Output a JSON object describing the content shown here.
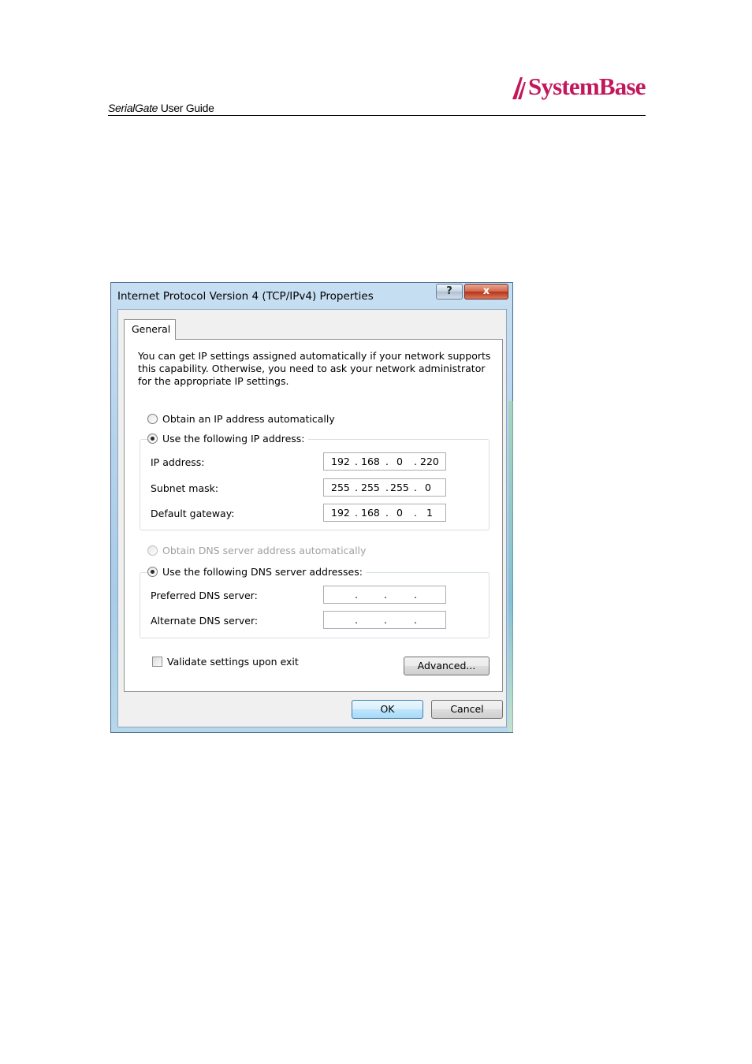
{
  "header": {
    "product": "SerialGate",
    "guide": " User Guide",
    "logo_text": "SystemBase"
  },
  "dialog": {
    "title": "Internet Protocol Version 4 (TCP/IPv4) Properties",
    "help_label": "?",
    "close_label": "x",
    "tab_general": "General",
    "intro": "You can get IP settings assigned automatically if your network supports this capability. Otherwise, you need to ask your network administrator for the appropriate IP settings.",
    "radio_auto_ip": "Obtain an IP address automatically",
    "radio_manual_ip": "Use the following IP address:",
    "ip_label": "IP address:",
    "ip": [
      "192",
      "168",
      "0",
      "220"
    ],
    "subnet_label": "Subnet mask:",
    "subnet": [
      "255",
      "255",
      "255",
      "0"
    ],
    "gateway_label": "Default gateway:",
    "gateway": [
      "192",
      "168",
      "0",
      "1"
    ],
    "radio_auto_dns": "Obtain DNS server address automatically",
    "radio_manual_dns": "Use the following DNS server addresses:",
    "pref_dns_label": "Preferred DNS server:",
    "alt_dns_label": "Alternate DNS server:",
    "validate_label": "Validate settings upon exit",
    "advanced_label": "Advanced...",
    "ok_label": "OK",
    "cancel_label": "Cancel",
    "dot": "."
  }
}
